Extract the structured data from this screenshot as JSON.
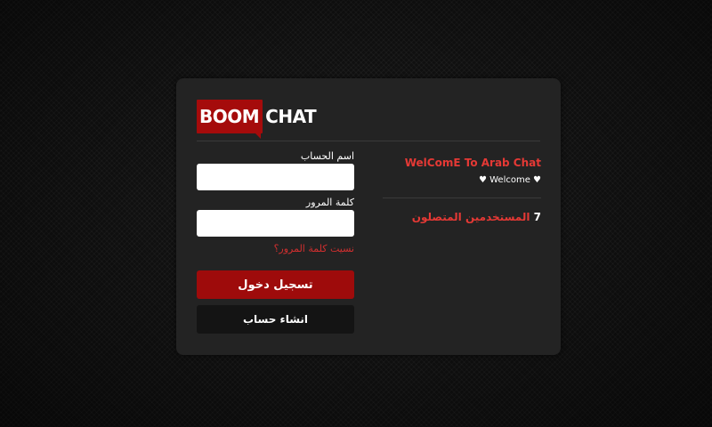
{
  "logo": {
    "boom": "BOOM",
    "chat": "CHAT"
  },
  "login_form": {
    "username_label": "اسم الحساب",
    "username_value": "",
    "password_label": "كلمة المرور",
    "password_value": "",
    "forgot_password": "نسيت كلمة المرور؟",
    "login_button": "تسجيل دخول",
    "register_button": "انشاء حساب"
  },
  "info": {
    "welcome_title": "WelComE To Arab Chat",
    "welcome_subtitle": "♥ Welcome ♥",
    "online_count": "7",
    "online_label": "المستخدمين المتصلون"
  },
  "colors": {
    "accent": "#a50b0b",
    "accent_text": "#e53935",
    "panel": "#232323",
    "background": "#111111"
  }
}
